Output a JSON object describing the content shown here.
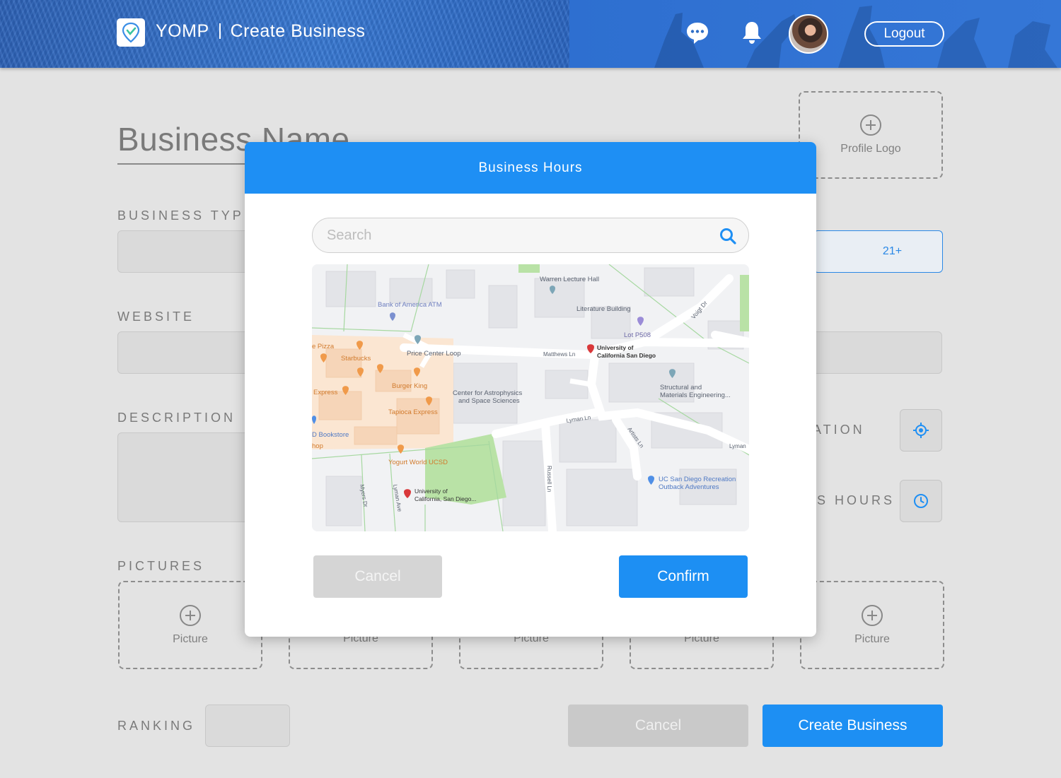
{
  "header": {
    "app_name": "YOMP",
    "page_title": "Create Business",
    "logout_label": "Logout"
  },
  "form": {
    "business_name_placeholder": "Business Name",
    "profile_logo_label": "Profile Logo",
    "business_type_label": "BUSINESS TYPE",
    "age_value": "21+",
    "website_label": "WEBSITE",
    "description_label": "DESCRIPTION",
    "location_label": "LOCATION",
    "hours_label": "S HOURS",
    "pictures_label": "PICTURES",
    "picture_caption": "Picture",
    "ranking_label": "RANKING",
    "cancel_label": "Cancel",
    "create_label": "Create Business"
  },
  "modal": {
    "title": "Business Hours",
    "search_placeholder": "Search",
    "cancel_label": "Cancel",
    "confirm_label": "Confirm",
    "map_labels": {
      "warren": "Warren Lecture Hall",
      "boa": "Bank of America ATM",
      "literature": "Literature Building",
      "lot": "Lot P508",
      "voigt": "Voigt Dr",
      "pizza": "e Pizza",
      "starbucks": "Starbucks",
      "price_center": "Price Center Loop",
      "matthews": "Matthews Ln",
      "ucsd1": "University of",
      "ucsd2": "California San Diego",
      "burger": "Burger King",
      "express": "Express",
      "astro1": "Center for Astrophysics",
      "astro2": "and Space Sciences",
      "struct1": "Structural and",
      "struct2": "Materials Engineering...",
      "tapioca": "Tapioca Express",
      "lyman1": "Lyman Ln",
      "lyman2": "Lyman",
      "bookstore": "D Bookstore",
      "shop": "hop",
      "artists": "Artists Ln",
      "yogurt": "Yogurt World UCSD",
      "russell": "Russell Ln",
      "rec1": "UC San Diego Recreation",
      "rec2": "Outback Adventures",
      "myers": "Myers Dr",
      "lymanave": "Lyman Ave",
      "ucsd3": "University of",
      "ucsd4": "California, San Diego..."
    }
  },
  "colors": {
    "accent": "#1e8ff4",
    "header": "#2f6ec6"
  }
}
